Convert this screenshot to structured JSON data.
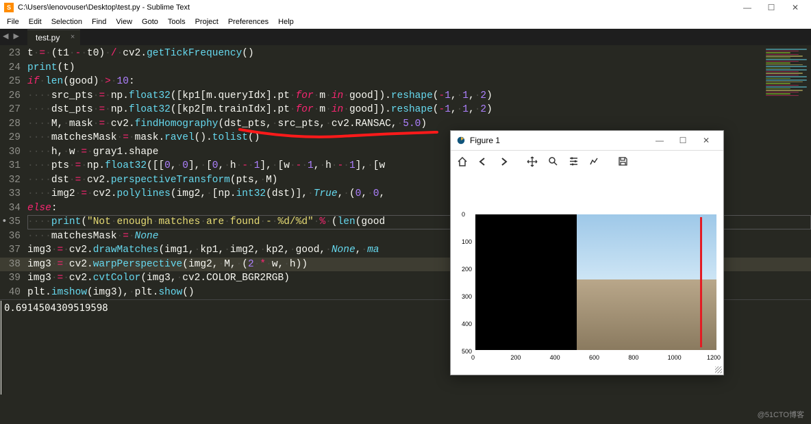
{
  "title_bar": {
    "path": "C:\\Users\\lenovouser\\Desktop\\test.py - Sublime Text",
    "icon_letter": "S"
  },
  "menu": [
    "File",
    "Edit",
    "Selection",
    "Find",
    "View",
    "Goto",
    "Tools",
    "Project",
    "Preferences",
    "Help"
  ],
  "tab": {
    "label": "test.py",
    "close_glyph": "×"
  },
  "window_controls": {
    "minimize": "—",
    "maximize": "☐",
    "close": "✕"
  },
  "lines": [
    {
      "n": 23,
      "html": "t<span class='ws'>·</span><span class='c-op'>=</span><span class='ws'>·</span>(t1<span class='ws'>·</span><span class='c-op'>-</span><span class='ws'>·</span>t0)<span class='ws'>·</span><span class='c-op'>/</span><span class='ws'>·</span>cv2.<span class='c-call'>getTickFrequency</span>()"
    },
    {
      "n": 24,
      "html": "<span class='c-call'>print</span>(t)"
    },
    {
      "n": 25,
      "html": "<span class='c-kw'>if</span><span class='ws'>·</span><span class='c-call'>len</span>(good)<span class='ws'>·</span><span class='c-op'>&gt;</span><span class='ws'>·</span><span class='c-num'>10</span>:"
    },
    {
      "n": 26,
      "html": "<span class='ws'>····</span>src_pts<span class='ws'>·</span><span class='c-op'>=</span><span class='ws'>·</span>np.<span class='c-call'>float32</span>([kp1[m.queryIdx].pt<span class='ws'>·</span><span class='c-kw'>for</span><span class='ws'>·</span>m<span class='ws'>·</span><span class='c-kw'>in</span><span class='ws'>·</span>good]).<span class='c-call'>reshape</span>(<span class='c-op'>-</span><span class='c-num'>1</span>,<span class='ws'>·</span><span class='c-num'>1</span>,<span class='ws'>·</span><span class='c-num'>2</span>)"
    },
    {
      "n": 27,
      "html": "<span class='ws'>····</span>dst_pts<span class='ws'>·</span><span class='c-op'>=</span><span class='ws'>·</span>np.<span class='c-call'>float32</span>([kp2[m.trainIdx].pt<span class='ws'>·</span><span class='c-kw'>for</span><span class='ws'>·</span>m<span class='ws'>·</span><span class='c-kw'>in</span><span class='ws'>·</span>good]).<span class='c-call'>reshape</span>(<span class='c-op'>-</span><span class='c-num'>1</span>,<span class='ws'>·</span><span class='c-num'>1</span>,<span class='ws'>·</span><span class='c-num'>2</span>)"
    },
    {
      "n": 28,
      "html": "<span class='ws'>····</span>M,<span class='ws'>·</span>mask<span class='ws'>·</span><span class='c-op'>=</span><span class='ws'>·</span>cv2.<span class='c-call'>findHomography</span>(dst_pts,<span class='ws'>·</span>src_pts,<span class='ws'>·</span>cv2.RANSAC,<span class='ws'>·</span><span class='c-num'>5.0</span>)"
    },
    {
      "n": 29,
      "html": "<span class='ws'>····</span>matchesMask<span class='ws'>·</span><span class='c-op'>=</span><span class='ws'>·</span>mask.<span class='c-call'>ravel</span>().<span class='c-call'>tolist</span>()"
    },
    {
      "n": 30,
      "html": "<span class='ws'>····</span>h,<span class='ws'>·</span>w<span class='ws'>·</span><span class='c-op'>=</span><span class='ws'>·</span>gray1.shape"
    },
    {
      "n": 31,
      "html": "<span class='ws'>····</span>pts<span class='ws'>·</span><span class='c-op'>=</span><span class='ws'>·</span>np.<span class='c-call'>float32</span>([[<span class='c-num'>0</span>,<span class='ws'>·</span><span class='c-num'>0</span>],<span class='ws'>·</span>[<span class='c-num'>0</span>,<span class='ws'>·</span>h<span class='ws'>·</span><span class='c-op'>-</span><span class='ws'>·</span><span class='c-num'>1</span>],<span class='ws'>·</span>[w<span class='ws'>·</span><span class='c-op'>-</span><span class='ws'>·</span><span class='c-num'>1</span>,<span class='ws'>·</span>h<span class='ws'>·</span><span class='c-op'>-</span><span class='ws'>·</span><span class='c-num'>1</span>],<span class='ws'>·</span>[w"
    },
    {
      "n": 32,
      "html": "<span class='ws'>····</span>dst<span class='ws'>·</span><span class='c-op'>=</span><span class='ws'>·</span>cv2.<span class='c-call'>perspectiveTransform</span>(pts,<span class='ws'>·</span>M)"
    },
    {
      "n": 33,
      "html": "<span class='ws'>····</span>img2<span class='ws'>·</span><span class='c-op'>=</span><span class='ws'>·</span>cv2.<span class='c-call'>polylines</span>(img2,<span class='ws'>·</span>[np.<span class='c-call'>int32</span>(dst)],<span class='ws'>·</span><span class='c-const'>True</span>,<span class='ws'>·</span>(<span class='c-num'>0</span>,<span class='ws'>·</span><span class='c-num'>0</span>,"
    },
    {
      "n": 34,
      "html": "<span class='c-kw'>else</span>:"
    },
    {
      "n": 35,
      "dirty": true,
      "boxed": true,
      "html": "<span class='ws'>····</span><span class='c-call'>print</span>(<span class='c-str'>\"Not<span class='ws'>·</span>enough<span class='ws'>·</span>matches<span class='ws'>·</span>are<span class='ws'>·</span>found<span class='ws'>·</span>-<span class='ws'>·</span>%d/%d\"</span><span class='ws'>·</span><span class='c-op'>%</span><span class='ws'>·</span>(<span class='c-call'>len</span>(good"
    },
    {
      "n": 36,
      "html": "<span class='ws'>····</span>matchesMask<span class='ws'>·</span><span class='c-op'>=</span><span class='ws'>·</span><span class='c-const'>None</span>"
    },
    {
      "n": 37,
      "html": "img3<span class='ws'>·</span><span class='c-op'>=</span><span class='ws'>·</span>cv2.<span class='c-call'>drawMatches</span>(img1,<span class='ws'>·</span>kp1,<span class='ws'>·</span>img2,<span class='ws'>·</span>kp2,<span class='ws'>·</span>good,<span class='ws'>·</span><span class='c-const'>None</span>,<span class='ws'>·</span><span class='c-type'>ma</span>"
    },
    {
      "n": 38,
      "hl": true,
      "html": "img3<span class='ws'>·</span><span class='c-op'>=</span><span class='ws'>·</span>cv2.<span class='c-call'>warpPerspective</span>(img2,<span class='ws'>·</span>M,<span class='ws'>·</span>(<span class='c-num'>2</span><span class='ws'>·</span><span class='c-op'>*</span><span class='ws'>·</span>w,<span class='ws'>·</span>h))"
    },
    {
      "n": 39,
      "html": "img3<span class='ws'>·</span><span class='c-op'>=</span><span class='ws'>·</span>cv2.<span class='c-call'>cvtColor</span>(img3,<span class='ws'>·</span>cv2.COLOR_BGR2RGB)"
    },
    {
      "n": 40,
      "html": "plt.<span class='c-call'>imshow</span>(img3),<span class='ws'>·</span>plt.<span class='c-call'>show</span>()"
    }
  ],
  "console_output": "0.6914504309519598",
  "figure": {
    "title": "Figure 1",
    "toolbar": {
      "home": "⌂",
      "back": "←",
      "forward": "→",
      "pan": "✥",
      "zoom": "🔍",
      "config": "☰",
      "subplots": "≋",
      "line": "〰",
      "save": "💾"
    },
    "y_ticks": [
      "0",
      "100",
      "200",
      "300",
      "400",
      "500"
    ],
    "x_ticks": [
      "0",
      "200",
      "400",
      "600",
      "800",
      "1000",
      "1200"
    ]
  },
  "chart_data": {
    "type": "image",
    "title": "",
    "xlim": [
      0,
      1280
    ],
    "ylim": [
      0,
      520
    ],
    "x_ticks": [
      0,
      200,
      400,
      600,
      800,
      1000,
      1200
    ],
    "y_ticks": [
      0,
      100,
      200,
      300,
      400,
      500
    ],
    "description": "Warped perspective output; left ~42% black region, right portion outdoor winter scene with sky and ground, vertical red line near x≈1230"
  },
  "watermark": "@51CTO博客"
}
